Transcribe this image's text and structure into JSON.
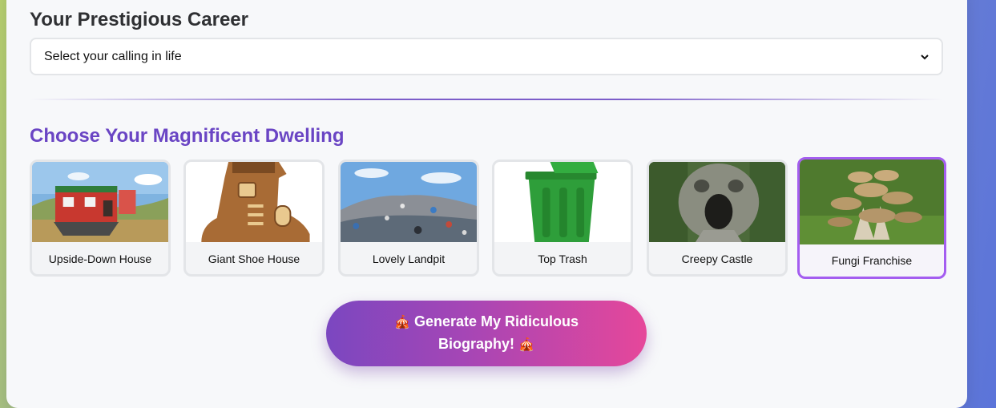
{
  "career": {
    "title": "Your Prestigious Career",
    "select_value": "Select your calling in life",
    "chevron_icon": "chevron-down-icon"
  },
  "dwelling": {
    "title": "Choose Your Magnificent Dwelling",
    "options": [
      {
        "label": "Upside-Down House",
        "selected": false
      },
      {
        "label": "Giant Shoe House",
        "selected": false
      },
      {
        "label": "Lovely Landpit",
        "selected": false
      },
      {
        "label": "Top Trash",
        "selected": false
      },
      {
        "label": "Creepy Castle",
        "selected": false
      },
      {
        "label": "Fungi Franchise",
        "selected": true
      }
    ]
  },
  "generate": {
    "icon": "🎪",
    "label": "Generate My Ridiculous Biography!"
  },
  "colors": {
    "accent_purple": "#6a45c4",
    "selected_border": "#a45df0",
    "button_start": "#7b47c0",
    "button_end": "#e6479a"
  }
}
